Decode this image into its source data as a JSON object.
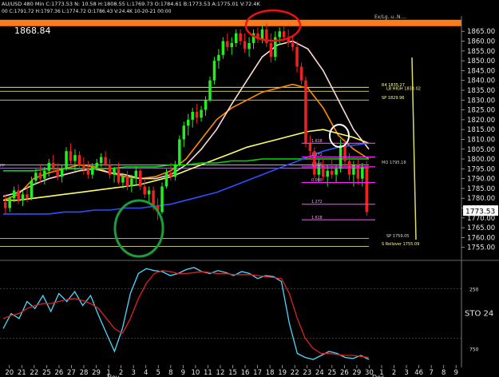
{
  "header": {
    "symbol_line": "AU/USD 480 Min  C:1773.53  N:  10.58  H:1808.55  L:1769.73  O:1784.61  B:1773.53  A:1775.01  V:72.4K",
    "ma_line": "00  C:1791.72  H:1797.36  L:1774.72  O:1786.43  V:24.4K  10-20-21  00:00"
  },
  "chart_data": [
    {
      "type": "candlestick",
      "title": "",
      "ylim": [
        1750,
        1872
      ],
      "yticks": [
        1865,
        1860,
        1855,
        1850,
        1845,
        1840,
        1835,
        1830,
        1825,
        1820,
        1815,
        1810,
        1805,
        1800,
        1795,
        1790,
        1785,
        1780,
        1775,
        1770,
        1765,
        1760,
        1755
      ],
      "ytick_labels": [
        "1865.00",
        "1860.00",
        "1855.00",
        "1850.00",
        "1845.00",
        "1840.00",
        "1835.00",
        "1830.00",
        "1825.00",
        "1820.00",
        "1815.00",
        "1810.00",
        "1805.00",
        "1800.00",
        "1795.00",
        "1790.00",
        "1785.00",
        "1780.00",
        "1775.00",
        "1770.00",
        "1765.00",
        "1760.00",
        "1755.00"
      ],
      "last_price_label": "1773.53",
      "high_label": "1868.84",
      "candles": [
        {
          "o": 1778,
          "h": 1782,
          "l": 1772,
          "c": 1775
        },
        {
          "o": 1775,
          "h": 1781,
          "l": 1773,
          "c": 1780
        },
        {
          "o": 1780,
          "h": 1786,
          "l": 1778,
          "c": 1784
        },
        {
          "o": 1784,
          "h": 1787,
          "l": 1777,
          "c": 1779
        },
        {
          "o": 1779,
          "h": 1784,
          "l": 1776,
          "c": 1782
        },
        {
          "o": 1782,
          "h": 1786,
          "l": 1778,
          "c": 1780
        },
        {
          "o": 1780,
          "h": 1791,
          "l": 1779,
          "c": 1789
        },
        {
          "o": 1789,
          "h": 1795,
          "l": 1787,
          "c": 1793
        },
        {
          "o": 1793,
          "h": 1797,
          "l": 1788,
          "c": 1790
        },
        {
          "o": 1790,
          "h": 1796,
          "l": 1787,
          "c": 1794
        },
        {
          "o": 1794,
          "h": 1800,
          "l": 1791,
          "c": 1798
        },
        {
          "o": 1798,
          "h": 1802,
          "l": 1793,
          "c": 1795
        },
        {
          "o": 1795,
          "h": 1798,
          "l": 1789,
          "c": 1791
        },
        {
          "o": 1791,
          "h": 1797,
          "l": 1788,
          "c": 1795
        },
        {
          "o": 1795,
          "h": 1806,
          "l": 1794,
          "c": 1804
        },
        {
          "o": 1804,
          "h": 1808,
          "l": 1797,
          "c": 1799
        },
        {
          "o": 1799,
          "h": 1805,
          "l": 1794,
          "c": 1802
        },
        {
          "o": 1802,
          "h": 1804,
          "l": 1795,
          "c": 1797
        },
        {
          "o": 1797,
          "h": 1801,
          "l": 1792,
          "c": 1795
        },
        {
          "o": 1795,
          "h": 1799,
          "l": 1790,
          "c": 1792
        },
        {
          "o": 1792,
          "h": 1798,
          "l": 1790,
          "c": 1796
        },
        {
          "o": 1796,
          "h": 1800,
          "l": 1794,
          "c": 1798
        },
        {
          "o": 1798,
          "h": 1803,
          "l": 1796,
          "c": 1801
        },
        {
          "o": 1801,
          "h": 1804,
          "l": 1796,
          "c": 1797
        },
        {
          "o": 1797,
          "h": 1800,
          "l": 1790,
          "c": 1792
        },
        {
          "o": 1792,
          "h": 1796,
          "l": 1788,
          "c": 1795
        },
        {
          "o": 1795,
          "h": 1798,
          "l": 1787,
          "c": 1788
        },
        {
          "o": 1788,
          "h": 1793,
          "l": 1785,
          "c": 1791
        },
        {
          "o": 1791,
          "h": 1794,
          "l": 1784,
          "c": 1786
        },
        {
          "o": 1786,
          "h": 1792,
          "l": 1783,
          "c": 1790
        },
        {
          "o": 1790,
          "h": 1796,
          "l": 1787,
          "c": 1794
        },
        {
          "o": 1794,
          "h": 1796,
          "l": 1784,
          "c": 1786
        },
        {
          "o": 1786,
          "h": 1790,
          "l": 1780,
          "c": 1782
        },
        {
          "o": 1782,
          "h": 1786,
          "l": 1778,
          "c": 1784
        },
        {
          "o": 1784,
          "h": 1786,
          "l": 1774,
          "c": 1776
        },
        {
          "o": 1776,
          "h": 1780,
          "l": 1769,
          "c": 1773
        },
        {
          "o": 1773,
          "h": 1788,
          "l": 1772,
          "c": 1786
        },
        {
          "o": 1786,
          "h": 1795,
          "l": 1785,
          "c": 1793
        },
        {
          "o": 1793,
          "h": 1798,
          "l": 1789,
          "c": 1791
        },
        {
          "o": 1791,
          "h": 1799,
          "l": 1789,
          "c": 1797
        },
        {
          "o": 1797,
          "h": 1812,
          "l": 1796,
          "c": 1810
        },
        {
          "o": 1810,
          "h": 1819,
          "l": 1806,
          "c": 1817
        },
        {
          "o": 1817,
          "h": 1823,
          "l": 1812,
          "c": 1820
        },
        {
          "o": 1820,
          "h": 1826,
          "l": 1816,
          "c": 1824
        },
        {
          "o": 1824,
          "h": 1828,
          "l": 1818,
          "c": 1821
        },
        {
          "o": 1821,
          "h": 1827,
          "l": 1819,
          "c": 1825
        },
        {
          "o": 1825,
          "h": 1832,
          "l": 1822,
          "c": 1830
        },
        {
          "o": 1830,
          "h": 1842,
          "l": 1829,
          "c": 1840
        },
        {
          "o": 1840,
          "h": 1852,
          "l": 1838,
          "c": 1850
        },
        {
          "o": 1850,
          "h": 1856,
          "l": 1846,
          "c": 1853
        },
        {
          "o": 1853,
          "h": 1862,
          "l": 1851,
          "c": 1860
        },
        {
          "o": 1860,
          "h": 1864,
          "l": 1855,
          "c": 1857
        },
        {
          "o": 1857,
          "h": 1862,
          "l": 1853,
          "c": 1859
        },
        {
          "o": 1859,
          "h": 1866,
          "l": 1857,
          "c": 1864
        },
        {
          "o": 1864,
          "h": 1866,
          "l": 1858,
          "c": 1860
        },
        {
          "o": 1860,
          "h": 1864,
          "l": 1854,
          "c": 1856
        },
        {
          "o": 1856,
          "h": 1862,
          "l": 1852,
          "c": 1859
        },
        {
          "o": 1859,
          "h": 1866,
          "l": 1856,
          "c": 1864
        },
        {
          "o": 1864,
          "h": 1867,
          "l": 1859,
          "c": 1861
        },
        {
          "o": 1861,
          "h": 1868,
          "l": 1859,
          "c": 1866
        },
        {
          "o": 1866,
          "h": 1869,
          "l": 1857,
          "c": 1859
        },
        {
          "o": 1859,
          "h": 1864,
          "l": 1849,
          "c": 1852
        },
        {
          "o": 1852,
          "h": 1865,
          "l": 1850,
          "c": 1862
        },
        {
          "o": 1862,
          "h": 1867,
          "l": 1858,
          "c": 1865
        },
        {
          "o": 1865,
          "h": 1868,
          "l": 1860,
          "c": 1862
        },
        {
          "o": 1862,
          "h": 1866,
          "l": 1857,
          "c": 1859
        },
        {
          "o": 1859,
          "h": 1863,
          "l": 1855,
          "c": 1857
        },
        {
          "o": 1857,
          "h": 1860,
          "l": 1844,
          "c": 1847
        },
        {
          "o": 1847,
          "h": 1849,
          "l": 1838,
          "c": 1840
        },
        {
          "o": 1840,
          "h": 1842,
          "l": 1806,
          "c": 1808
        },
        {
          "o": 1808,
          "h": 1812,
          "l": 1800,
          "c": 1804
        },
        {
          "o": 1804,
          "h": 1806,
          "l": 1790,
          "c": 1792
        },
        {
          "o": 1792,
          "h": 1800,
          "l": 1788,
          "c": 1797
        },
        {
          "o": 1797,
          "h": 1800,
          "l": 1789,
          "c": 1791
        },
        {
          "o": 1791,
          "h": 1797,
          "l": 1786,
          "c": 1794
        },
        {
          "o": 1794,
          "h": 1800,
          "l": 1790,
          "c": 1792
        },
        {
          "o": 1792,
          "h": 1797,
          "l": 1788,
          "c": 1795
        },
        {
          "o": 1795,
          "h": 1810,
          "l": 1793,
          "c": 1807
        },
        {
          "o": 1807,
          "h": 1810,
          "l": 1796,
          "c": 1799
        },
        {
          "o": 1799,
          "h": 1803,
          "l": 1789,
          "c": 1792
        },
        {
          "o": 1792,
          "h": 1799,
          "l": 1786,
          "c": 1797
        },
        {
          "o": 1797,
          "h": 1800,
          "l": 1787,
          "c": 1790
        },
        {
          "o": 1790,
          "h": 1798,
          "l": 1786,
          "c": 1796
        },
        {
          "o": 1796,
          "h": 1799,
          "l": 1771,
          "c": 1773
        }
      ],
      "moving_averages": [
        {
          "color": "#ff8c00",
          "values": [
            1779,
            1782,
            1790,
            1793,
            1795,
            1797,
            1796,
            1793,
            1791,
            1790,
            1791,
            1794,
            1800,
            1810,
            1820,
            1826,
            1830,
            1834,
            1836,
            1838,
            1836,
            1826,
            1812,
            1805,
            1800
          ]
        },
        {
          "color": "#ffd8d8",
          "values": [
            1781,
            1783,
            1787,
            1790,
            1792,
            1794,
            1795,
            1793,
            1792,
            1790,
            1790,
            1792,
            1797,
            1805,
            1815,
            1828,
            1840,
            1852,
            1858,
            1860,
            1856,
            1845,
            1830,
            1815,
            1805
          ]
        },
        {
          "color": "#ffff66",
          "values": [
            1779,
            1779,
            1780,
            1781,
            1782,
            1783,
            1784,
            1785,
            1786,
            1787,
            1789,
            1791,
            1794,
            1797,
            1800,
            1803,
            1806,
            1808,
            1810,
            1812,
            1814,
            1815,
            1813,
            1811,
            1808
          ]
        },
        {
          "color": "#00dd00",
          "values": [
            1794,
            1794,
            1794,
            1795,
            1795,
            1795,
            1795,
            1795,
            1796,
            1796,
            1796,
            1797,
            1797,
            1798,
            1798,
            1799,
            1799,
            1800,
            1800,
            1800,
            1800,
            1800,
            1800,
            1800,
            1800
          ]
        },
        {
          "color": "#2f4fff",
          "values": [
            1772,
            1772,
            1772,
            1772,
            1773,
            1773,
            1774,
            1774,
            1775,
            1775,
            1776,
            1777,
            1779,
            1781,
            1783,
            1786,
            1789,
            1792,
            1795,
            1798,
            1801,
            1804,
            1806,
            1807,
            1808
          ]
        }
      ],
      "horizontal_levels": [
        {
          "value": 1836.5,
          "color": "#ffff88",
          "label": "R4  1835.27"
        },
        {
          "value": 1834.5,
          "color": "#ffff88",
          "label": "LB HIGH 1833.02"
        },
        {
          "value": 1830,
          "color": "#ffff88",
          "label": "SP 1829.96"
        },
        {
          "value": 1795.3,
          "color": "#cc88ff",
          "label": "PP"
        },
        {
          "value": 1797,
          "color": "#cccccc",
          "label": "MO 1795.18"
        },
        {
          "value": 1759.5,
          "color": "#dddddd",
          "label": "SP 1759.05"
        },
        {
          "value": 1755.5,
          "color": "#ffff88",
          "label": "S Rollover 1755.09"
        }
      ],
      "fib_labels": [
        {
          "value": 1808,
          "label": "1.618"
        },
        {
          "value": 1801,
          "label": "1.272"
        },
        {
          "value": 1796,
          "label": "1.000"
        },
        {
          "value": 1788,
          "label": "0.000"
        },
        {
          "value": 1777,
          "label": "1.272"
        },
        {
          "value": 1769,
          "label": "1.618"
        }
      ],
      "x_tick_labels": [
        "20",
        "21",
        "22",
        "25",
        "26",
        "27",
        "28",
        "29",
        "1",
        "2",
        "3",
        "4",
        "5",
        "8",
        "9",
        "10",
        "11",
        "12",
        "15",
        "16",
        "17",
        "18",
        "19",
        "22",
        "23",
        "24",
        "25",
        "26",
        "29",
        "30",
        "1",
        "2",
        "3",
        "46",
        "7",
        "8",
        "9"
      ],
      "month_labels": [
        "Nov",
        "Dec"
      ]
    },
    {
      "type": "line",
      "title": "",
      "ylim": [
        0,
        100
      ],
      "ytick_labels": [
        "250",
        "STO 24",
        "750"
      ],
      "series": [
        {
          "color": "#4fd8ff",
          "values": [
            35,
            50,
            45,
            62,
            55,
            68,
            52,
            70,
            62,
            72,
            58,
            68,
            48,
            30,
            12,
            35,
            70,
            90,
            95,
            93,
            92,
            88,
            90,
            94,
            96,
            92,
            90,
            93,
            91,
            88,
            92,
            90,
            85,
            88,
            87,
            82,
            40,
            10,
            6,
            4,
            8,
            12,
            10,
            6,
            5,
            8,
            4
          ]
        },
        {
          "color": "#dd2222",
          "values": [
            45,
            48,
            50,
            55,
            58,
            60,
            60,
            62,
            64,
            65,
            63,
            60,
            55,
            45,
            35,
            30,
            45,
            65,
            80,
            90,
            93,
            92,
            90,
            90,
            91,
            92,
            91,
            90,
            90,
            89,
            89,
            89,
            88,
            87,
            86,
            85,
            70,
            45,
            25,
            15,
            10,
            10,
            9,
            8,
            8,
            7,
            6
          ]
        }
      ]
    }
  ],
  "annotations": {
    "top_text": "Ex/Lg..u..N...."
  }
}
